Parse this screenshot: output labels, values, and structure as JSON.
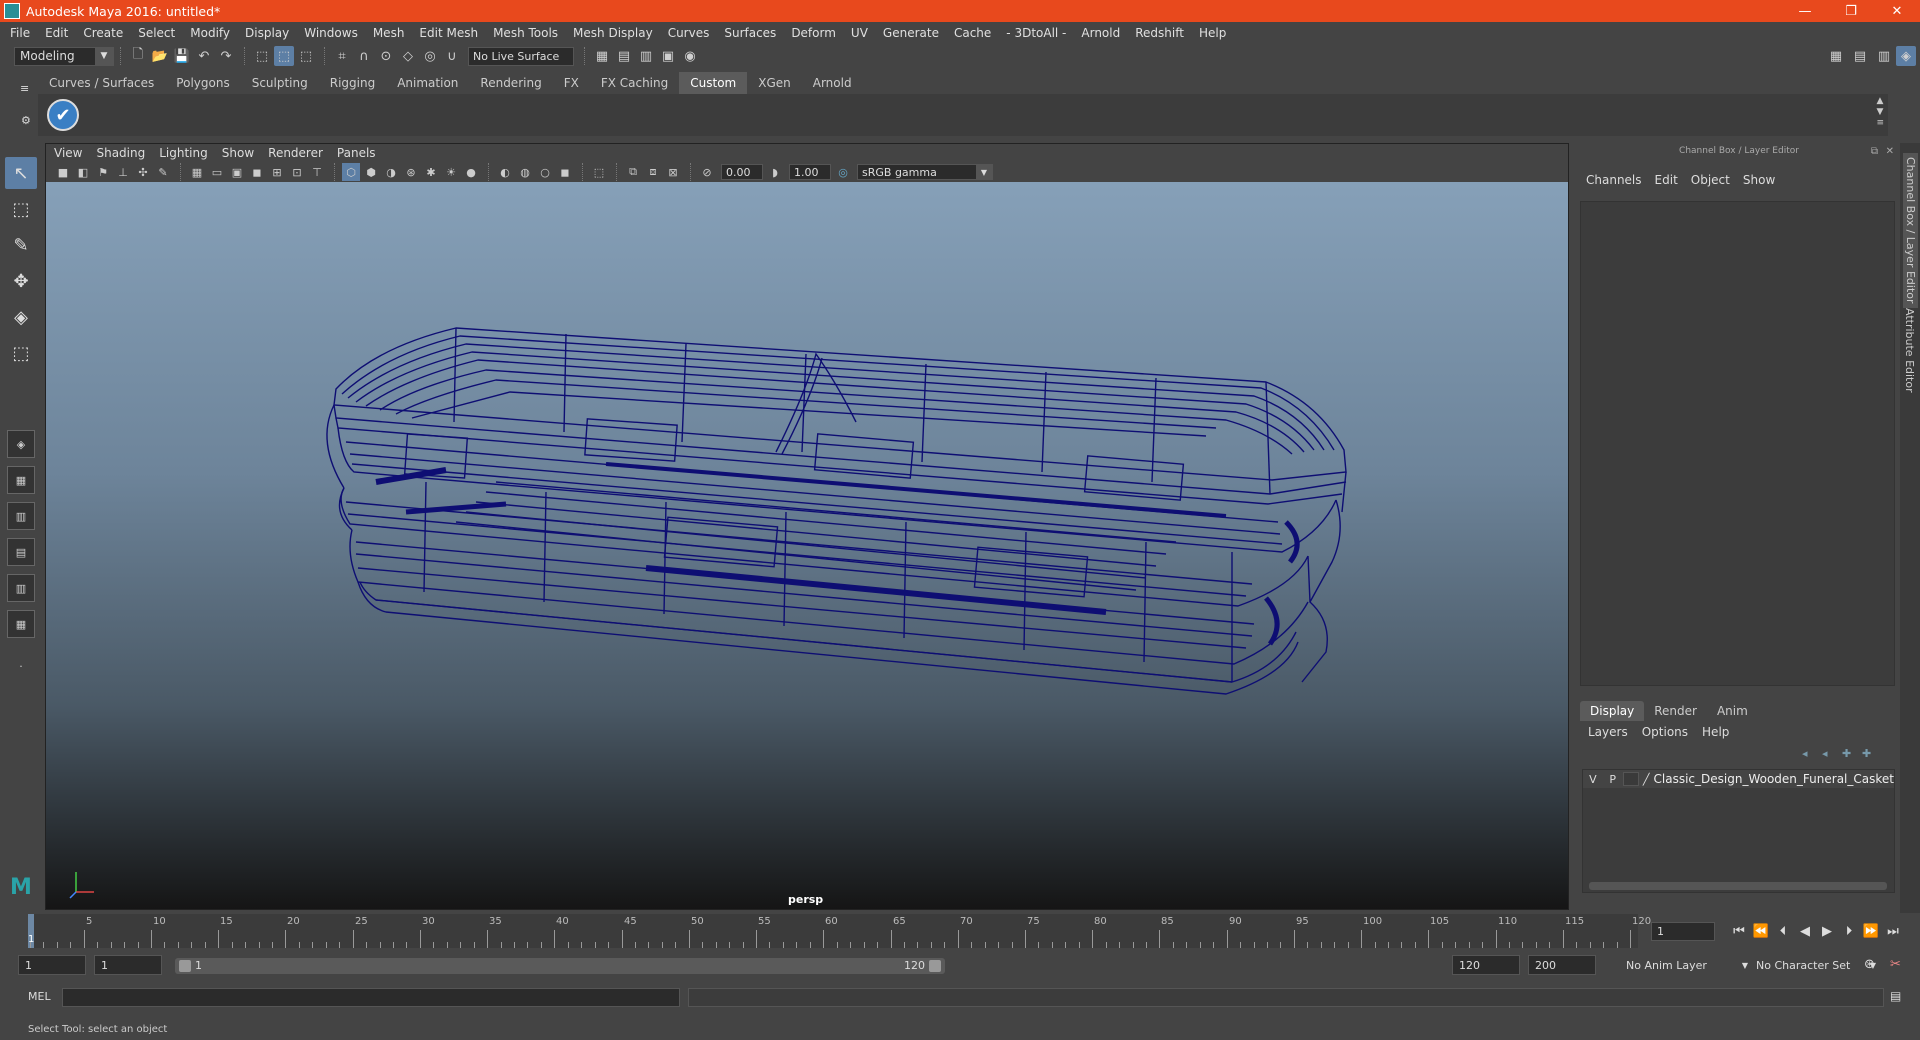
{
  "window": {
    "title": "Autodesk Maya 2016: untitled*",
    "minimize": "—",
    "maximize": "❐",
    "close": "✕"
  },
  "menubar": [
    "File",
    "Edit",
    "Create",
    "Select",
    "Modify",
    "Display",
    "Windows",
    "Mesh",
    "Edit Mesh",
    "Mesh Tools",
    "Mesh Display",
    "Curves",
    "Surfaces",
    "Deform",
    "UV",
    "Generate",
    "Cache",
    "- 3DtoAll -",
    "Arnold",
    "Redshift",
    "Help"
  ],
  "statusline": {
    "mode": "Modeling",
    "live_surface": "No Live Surface"
  },
  "shelf": {
    "tabs": [
      "Curves / Surfaces",
      "Polygons",
      "Sculpting",
      "Rigging",
      "Animation",
      "Rendering",
      "FX",
      "FX Caching",
      "Custom",
      "XGen",
      "Arnold"
    ],
    "active_tab": "Custom"
  },
  "viewport": {
    "menu": [
      "View",
      "Shading",
      "Lighting",
      "Show",
      "Renderer",
      "Panels"
    ],
    "exposure": "0.00",
    "gamma": "1.00",
    "color_space": "sRGB gamma",
    "camera_label": "persp"
  },
  "channel_box": {
    "header": "Channel Box / Layer Editor",
    "menu": [
      "Channels",
      "Edit",
      "Object",
      "Show"
    ]
  },
  "layer_editor": {
    "tabs": [
      "Display",
      "Render",
      "Anim"
    ],
    "active_tab": "Display",
    "menu": [
      "Layers",
      "Options",
      "Help"
    ],
    "layer": {
      "v": "V",
      "p": "P",
      "name": "Classic_Design_Wooden_Funeral_Casket"
    }
  },
  "side_tabs": {
    "channel_box": "Channel Box / Layer Editor",
    "attribute_editor": "Attribute Editor"
  },
  "timeline": {
    "labels": [
      "5",
      "10",
      "15",
      "20",
      "25",
      "30",
      "35",
      "40",
      "45",
      "50",
      "55",
      "60",
      "65",
      "70",
      "75",
      "80",
      "85",
      "90",
      "95",
      "100",
      "105",
      "110",
      "115",
      "120"
    ],
    "current_frame_label": "1",
    "current_frame": "1",
    "start": 1,
    "end": 120
  },
  "range": {
    "start_frame": "1",
    "playback_start": "1",
    "slider_start": "1",
    "slider_end": "120",
    "playback_end": "120",
    "end_frame": "200",
    "anim_layer": "No Anim Layer",
    "character_set": "No Character Set"
  },
  "command_line": {
    "label": "MEL"
  },
  "help_line": "Select Tool: select an object",
  "colors": {
    "titlebar": "#e8491d",
    "wireframe": "#0e0e73",
    "active_tool": "#5d7fa5"
  }
}
